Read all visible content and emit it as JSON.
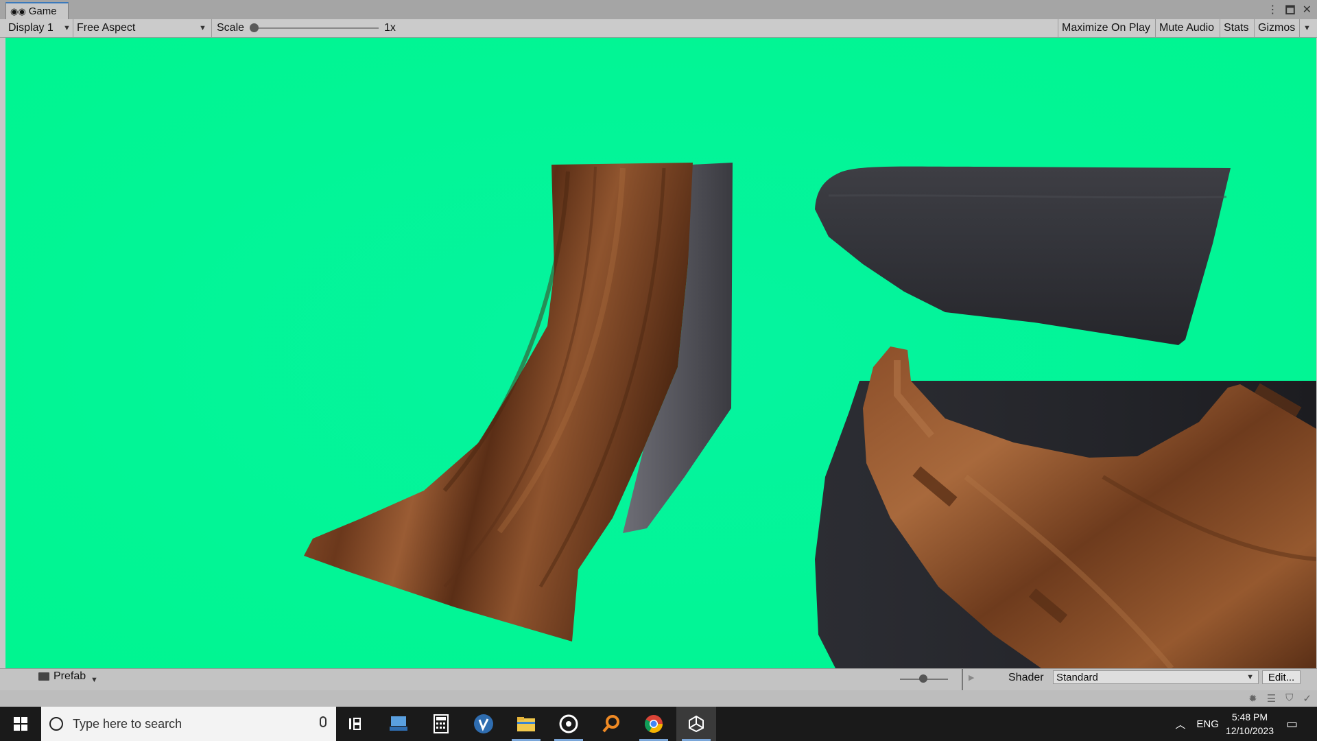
{
  "window": {
    "tab_title": "Game",
    "controls": [
      "⋮",
      "🗖",
      "✕"
    ]
  },
  "toolbar": {
    "display": "Display 1",
    "aspect": "Free Aspect",
    "scale_label": "Scale",
    "scale_value": "1x",
    "maximize_on_play": "Maximize On Play",
    "mute_audio": "Mute Audio",
    "stats": "Stats",
    "gizmos": "Gizmos"
  },
  "project": {
    "items": [
      "Prefab"
    ]
  },
  "inspector": {
    "shader_label": "Shader",
    "shader_value": "Standard",
    "edit_label": "Edit..."
  },
  "taskbar": {
    "search_placeholder": "Type here to search",
    "apps": [
      {
        "name": "task-view",
        "icon": "task-view-icon"
      },
      {
        "name": "pc",
        "icon": "computer-icon"
      },
      {
        "name": "calculator",
        "icon": "calculator-icon"
      },
      {
        "name": "vscode",
        "icon": "v-app-icon"
      },
      {
        "name": "file-explorer",
        "icon": "folder-icon"
      },
      {
        "name": "media",
        "icon": "disc-icon"
      },
      {
        "name": "search-app",
        "icon": "magnifier-icon"
      },
      {
        "name": "chrome",
        "icon": "chrome-icon"
      },
      {
        "name": "unity",
        "icon": "unity-icon"
      }
    ],
    "language": "ENG",
    "time": "5:48 PM",
    "date": "12/10/2023"
  },
  "colors": {
    "sky": "#02f596",
    "wood": "#7a4424",
    "metal": "#3c3c42",
    "accent": "#3a79bb"
  }
}
